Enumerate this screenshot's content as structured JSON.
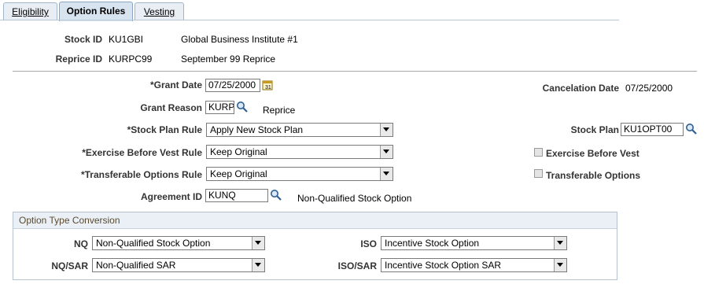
{
  "tabs": [
    {
      "label": "Eligibility",
      "active": false
    },
    {
      "label": "Option Rules",
      "active": true
    },
    {
      "label": "Vesting",
      "active": false
    }
  ],
  "header": {
    "stock_id_label": "Stock ID",
    "stock_id_value": "KU1GBI",
    "stock_id_desc": "Global Business Institute #1",
    "reprice_id_label": "Reprice ID",
    "reprice_id_value": "KURPC99",
    "reprice_id_desc": "September 99 Reprice"
  },
  "form": {
    "grant_date_label": "*Grant Date",
    "grant_date_value": "07/25/2000",
    "cancelation_date_label": "Cancelation Date",
    "cancelation_date_value": "07/25/2000",
    "grant_reason_label": "Grant Reason",
    "grant_reason_value": "KURP",
    "grant_reason_desc": "Reprice",
    "stock_plan_rule_label": "*Stock Plan Rule",
    "stock_plan_rule_value": "Apply New Stock Plan",
    "stock_plan_label": "Stock Plan",
    "stock_plan_value": "KU1OPT00",
    "exercise_before_vest_rule_label": "*Exercise Before Vest Rule",
    "exercise_before_vest_rule_value": "Keep Original",
    "exercise_before_vest_label": "Exercise Before Vest",
    "transferable_options_rule_label": "*Transferable Options Rule",
    "transferable_options_rule_value": "Keep Original",
    "transferable_options_label": "Transferable Options",
    "agreement_id_label": "Agreement ID",
    "agreement_id_value": "KUNQ",
    "agreement_id_desc": "Non-Qualified Stock Option"
  },
  "conversion": {
    "title": "Option Type Conversion",
    "nq_label": "NQ",
    "nq_value": "Non-Qualified Stock Option",
    "iso_label": "ISO",
    "iso_value": "Incentive Stock Option",
    "nqsar_label": "NQ/SAR",
    "nqsar_value": "Non-Qualified SAR",
    "isosar_label": "ISO/SAR",
    "isosar_value": "Incentive Stock Option SAR"
  },
  "colors": {
    "tab_active": "#d7e3ef",
    "group_header": "#eaf0f5",
    "group_title": "#5a4a2e"
  },
  "icons": [
    "calendar-icon",
    "lookup-icon",
    "dropdown-arrow-icon",
    "checkbox-icon"
  ]
}
